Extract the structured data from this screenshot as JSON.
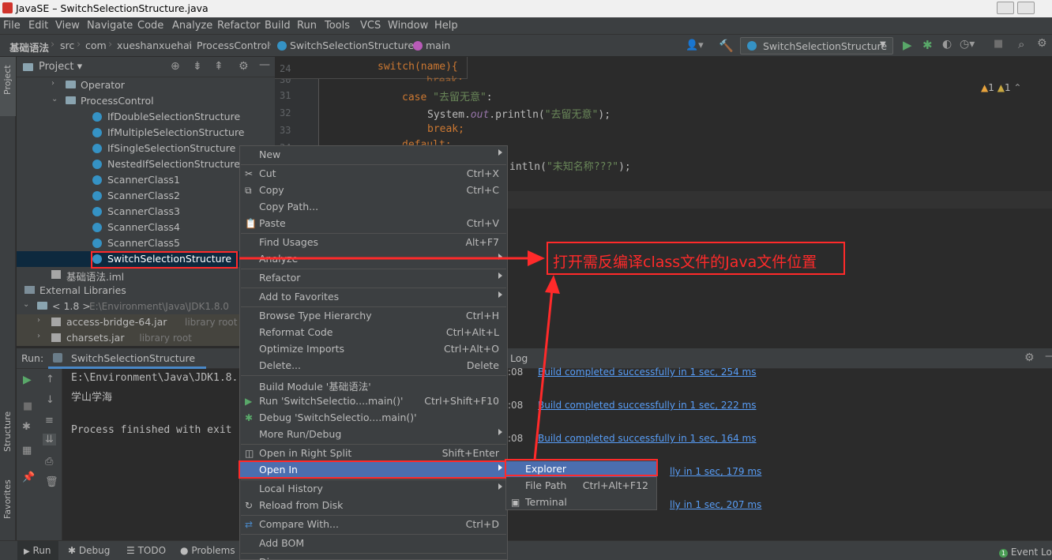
{
  "window": {
    "title": "JavaSE – SwitchSelectionStructure.java"
  },
  "menubar": [
    "File",
    "Edit",
    "View",
    "Navigate",
    "Code",
    "Analyze",
    "Refactor",
    "Build",
    "Run",
    "Tools",
    "VCS",
    "Window",
    "Help"
  ],
  "breadcrumb": [
    "基础语法",
    "src",
    "com",
    "xueshanxuehai",
    "ProcessControl",
    "SwitchSelectionStructure",
    "main"
  ],
  "run_config": "SwitchSelectionStructure",
  "left_strip": {
    "project": "Project",
    "structure": "Structure",
    "favorites": "Favorites"
  },
  "project_panel": {
    "title": "Project"
  },
  "project_tree": [
    {
      "label": "Operator",
      "kind": "folder"
    },
    {
      "label": "ProcessControl",
      "kind": "folder"
    },
    {
      "label": "IfDoubleSelectionStructure",
      "kind": "class"
    },
    {
      "label": "IfMultipleSelectionStructure",
      "kind": "class"
    },
    {
      "label": "IfSingleSelectionStructure",
      "kind": "class"
    },
    {
      "label": "NestedIfSelectionStructure",
      "kind": "class"
    },
    {
      "label": "ScannerClass1",
      "kind": "class"
    },
    {
      "label": "ScannerClass2",
      "kind": "class"
    },
    {
      "label": "ScannerClass3",
      "kind": "class"
    },
    {
      "label": "ScannerClass4",
      "kind": "class"
    },
    {
      "label": "ScannerClass5",
      "kind": "class"
    },
    {
      "label": "SwitchSelectionStructure",
      "kind": "class"
    },
    {
      "label": "基础语法.iml",
      "kind": "file"
    },
    {
      "label": "External Libraries",
      "kind": "lib"
    },
    {
      "label": "< 1.8 >",
      "hint": "E:\\Environment\\Java\\JDK1.8.0",
      "kind": "jdk"
    },
    {
      "label": "access-bridge-64.jar",
      "hint": "library root",
      "kind": "jar"
    },
    {
      "label": "charsets.jar",
      "hint": "library root",
      "kind": "jar"
    }
  ],
  "editor": {
    "line_numbers": [
      "24",
      "30",
      "31",
      "32",
      "33",
      "34"
    ],
    "code": {
      "switch_line": "switch(name){",
      "break_partial": "break;",
      "case_kw": "case",
      "case_str": "\"去留无意\"",
      "case_colon": ":",
      "print_prefix": "System.",
      "print_field": "out",
      "print_call": ".println(",
      "print_str": "\"去留无意\"",
      "print_end": ");",
      "break_kw": "break;",
      "default_kw": "default:",
      "default_print": "intln(",
      "default_str": "\"未知名称???\"",
      "default_end": ");"
    },
    "inspections": {
      "warnings": "1",
      "weak_warnings": "1"
    }
  },
  "run_panel": {
    "label": "Run:",
    "tab": "SwitchSelectionStructure",
    "console_lines": [
      "E:\\Environment\\Java\\JDK1.8.",
      "学山学海",
      "Process finished with exit"
    ],
    "build_log_title": "Log",
    "build_entries": [
      {
        "time": ":08",
        "text": "Build completed successfully in 1 sec, 254 ms"
      },
      {
        "time": ":08",
        "text": "Build completed successfully in 1 sec, 222 ms"
      },
      {
        "time": ":08",
        "text": "Build completed successfully in 1 sec, 164 ms"
      },
      {
        "time": "",
        "text": "lly in 1 sec, 179 ms"
      },
      {
        "time": "",
        "text": "lly in 1 sec, 207 ms"
      }
    ]
  },
  "context_menu": [
    {
      "label": "New",
      "shortcut": "",
      "submenu": true,
      "icon": ""
    },
    {
      "sep": true
    },
    {
      "label": "Cut",
      "shortcut": "Ctrl+X",
      "icon": "scissors-icon"
    },
    {
      "label": "Copy",
      "shortcut": "Ctrl+C",
      "icon": "copy-icon"
    },
    {
      "label": "Copy Path...",
      "shortcut": ""
    },
    {
      "label": "Paste",
      "shortcut": "Ctrl+V",
      "icon": "paste-icon"
    },
    {
      "sep": true
    },
    {
      "label": "Find Usages",
      "shortcut": "Alt+F7"
    },
    {
      "label": "Analyze",
      "shortcut": "",
      "submenu": true
    },
    {
      "sep": true
    },
    {
      "label": "Refactor",
      "shortcut": "",
      "submenu": true
    },
    {
      "sep": true
    },
    {
      "label": "Add to Favorites",
      "shortcut": "",
      "submenu": true
    },
    {
      "sep": true
    },
    {
      "label": "Browse Type Hierarchy",
      "shortcut": "Ctrl+H"
    },
    {
      "label": "Reformat Code",
      "shortcut": "Ctrl+Alt+L"
    },
    {
      "label": "Optimize Imports",
      "shortcut": "Ctrl+Alt+O"
    },
    {
      "label": "Delete...",
      "shortcut": "Delete"
    },
    {
      "sep": true
    },
    {
      "label": "Build Module '基础语法'",
      "shortcut": ""
    },
    {
      "label": "Run 'SwitchSelectio....main()'",
      "shortcut": "Ctrl+Shift+F10",
      "icon": "run-icon"
    },
    {
      "label": "Debug 'SwitchSelectio....main()'",
      "shortcut": "",
      "icon": "debug-icon"
    },
    {
      "label": "More Run/Debug",
      "shortcut": "",
      "submenu": true
    },
    {
      "sep": true
    },
    {
      "label": "Open in Right Split",
      "shortcut": "Shift+Enter",
      "icon": "split-icon"
    },
    {
      "label": "Open In",
      "shortcut": "",
      "submenu": true,
      "selected": true
    },
    {
      "sep": true
    },
    {
      "label": "Local History",
      "shortcut": "",
      "submenu": true
    },
    {
      "label": "Reload from Disk",
      "shortcut": "",
      "icon": "reload-icon"
    },
    {
      "sep": true
    },
    {
      "label": "Compare With...",
      "shortcut": "Ctrl+D",
      "icon": "compare-icon"
    },
    {
      "sep": true
    },
    {
      "label": "Add BOM",
      "shortcut": ""
    },
    {
      "sep": true
    },
    {
      "label": "Di",
      "shortcut": ""
    }
  ],
  "submenu_open_in": [
    {
      "label": "Explorer",
      "shortcut": "",
      "selected": true
    },
    {
      "label": "File Path",
      "shortcut": "Ctrl+Alt+F12"
    },
    {
      "label": "Terminal",
      "shortcut": "",
      "icon": "terminal-icon"
    }
  ],
  "annotation": {
    "text": "打开需反编译class文件的Java文件位置",
    "color": "#ff2a2a"
  },
  "bottom_tabs": [
    "Run",
    "Debug",
    "TODO",
    "Problems"
  ],
  "event_log": "Event Log",
  "colors": {
    "accent_selection": "#4b6eaf",
    "annotation_red": "#ff2a2a",
    "keyword": "#cc7832",
    "string": "#6a8759"
  }
}
